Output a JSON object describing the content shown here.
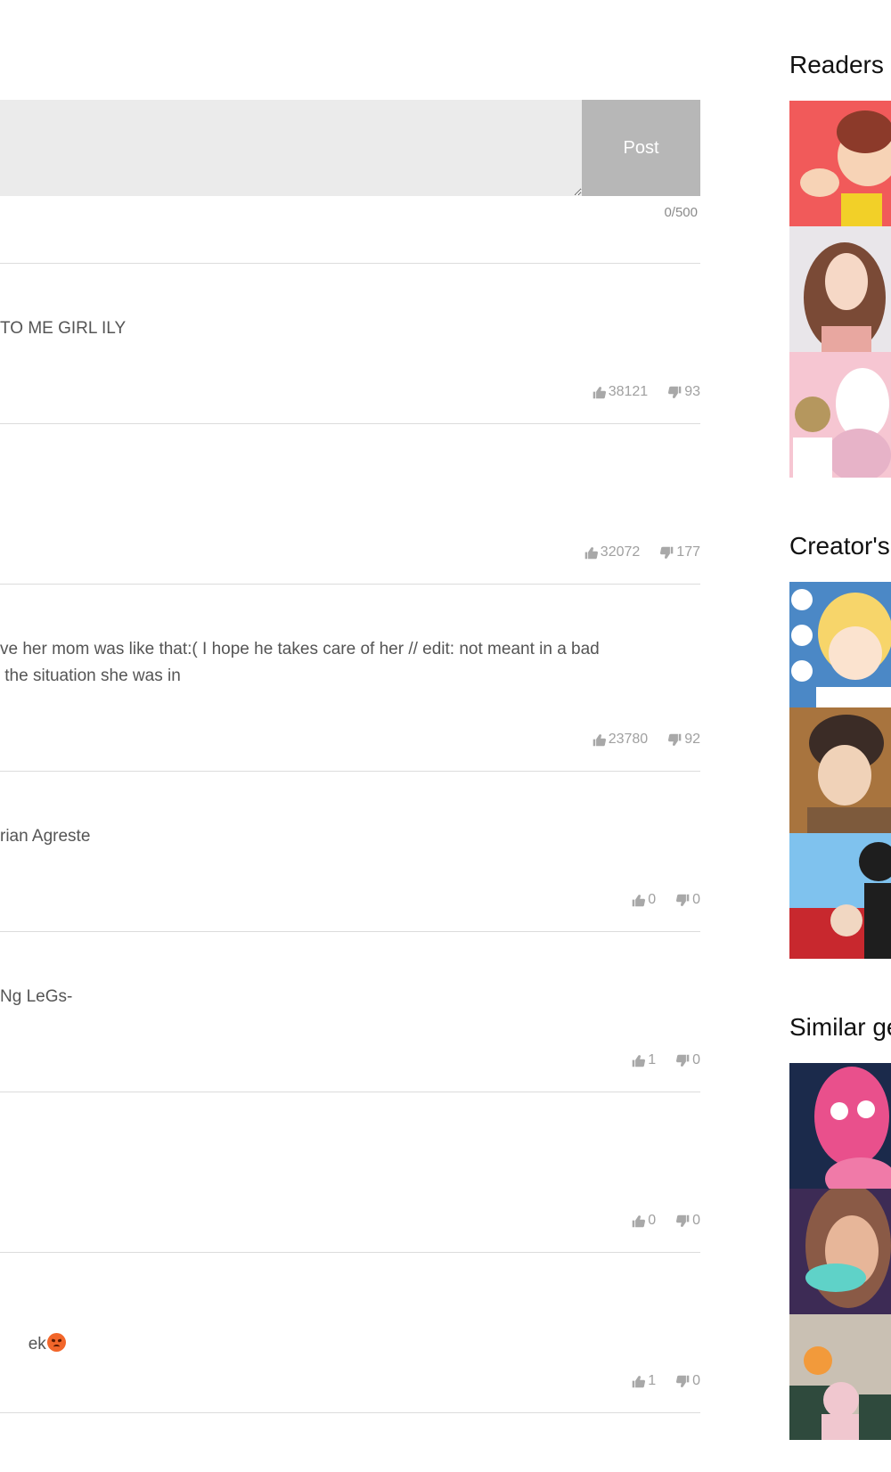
{
  "composer": {
    "post_label": "Post",
    "char_count": "0/500",
    "value": ""
  },
  "comments": [
    {
      "text": "TO ME GIRL ILY",
      "likes": "38121",
      "dislikes": "93"
    },
    {
      "text": "",
      "likes": "32072",
      "dislikes": "177"
    },
    {
      "text": "ve her mom was like that:( I hope he takes care of her // edit: not meant in a bad\n the situation she was in",
      "likes": "23780",
      "dislikes": "92"
    },
    {
      "text": "rian Agreste",
      "likes": "0",
      "dislikes": "0"
    },
    {
      "text": "Ng LeGs-",
      "likes": "1",
      "dislikes": "0"
    },
    {
      "text": "",
      "likes": "0",
      "dislikes": "0"
    },
    {
      "text": "ek",
      "likes": "1",
      "dislikes": "0",
      "emoji": "angry-face"
    }
  ],
  "sidebar": {
    "sections": [
      {
        "title": "Readers a",
        "thumbs": [
          {
            "palette": [
              "#f15a5a",
              "#f7d3b6",
              "#8c3a2a",
              "#f2d028"
            ]
          },
          {
            "palette": [
              "#e9e6ea",
              "#f6d8c6",
              "#7a4a36",
              "#e8a7a0"
            ]
          },
          {
            "palette": [
              "#f6c6d2",
              "#ffffff",
              "#e7b3c8",
              "#b5975e"
            ]
          }
        ]
      },
      {
        "title": "Creator's",
        "thumbs": [
          {
            "palette": [
              "#4b88c6",
              "#f7d56a",
              "#fbe3cf",
              "#ffffff"
            ]
          },
          {
            "palette": [
              "#a8743e",
              "#3b2c26",
              "#f0d2b8",
              "#7d5a3c"
            ]
          },
          {
            "palette": [
              "#7fc2ee",
              "#c8282e",
              "#1e1e1e",
              "#f1d7c2"
            ]
          }
        ]
      },
      {
        "title": "Similar ge",
        "thumbs": [
          {
            "palette": [
              "#1b2a4b",
              "#e9508c",
              "#f07aa8",
              "#ffffff"
            ]
          },
          {
            "palette": [
              "#3d2b55",
              "#8a5a46",
              "#e7b699",
              "#5fd2c8"
            ]
          },
          {
            "palette": [
              "#c9c0b3",
              "#2f4a3d",
              "#f29a3b",
              "#f0c7cf"
            ]
          }
        ]
      }
    ]
  }
}
